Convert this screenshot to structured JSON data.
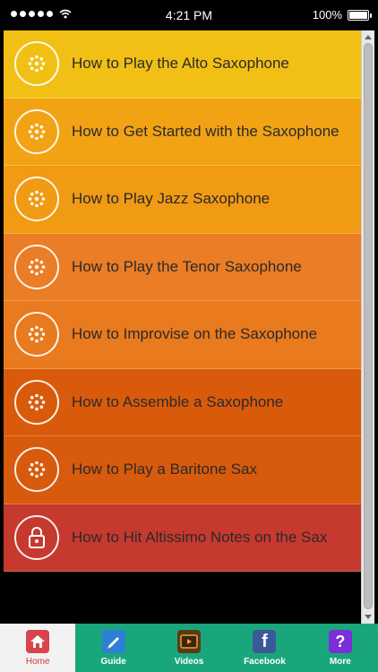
{
  "status_bar": {
    "time": "4:21 PM",
    "battery": "100%"
  },
  "list": [
    {
      "label": "How to Play the Alto Saxophone",
      "color": "#f2c014",
      "icon": "sax-dots-icon"
    },
    {
      "label": "How to Get Started with the Saxophone",
      "color": "#f2a314",
      "icon": "sax-dots-icon"
    },
    {
      "label": "How to Play Jazz Saxophone",
      "color": "#f19a14",
      "icon": "sax-dots-icon"
    },
    {
      "label": "How to Play the Tenor Saxophone",
      "color": "#ea7d26",
      "icon": "sax-dots-icon"
    },
    {
      "label": "How to Improvise on the Saxophone",
      "color": "#e97a1e",
      "icon": "sax-dots-icon"
    },
    {
      "label": "How to Assemble a Saxophone",
      "color": "#da5a0c",
      "icon": "sax-dots-icon"
    },
    {
      "label": "How to Play a Baritone Sax",
      "color": "#d85a0c",
      "icon": "sax-dots-icon"
    },
    {
      "label": "How to Hit Altissimo Notes on the Sax",
      "color": "#c6392f",
      "icon": "lock-icon"
    }
  ],
  "tabbar": {
    "background": "#1aa67c",
    "tabs": [
      {
        "label": "Home",
        "icon": "home-icon",
        "active": true
      },
      {
        "label": "Guide",
        "icon": "guide-icon",
        "active": false
      },
      {
        "label": "Videos",
        "icon": "videos-icon",
        "active": false
      },
      {
        "label": "Facebook",
        "icon": "facebook-icon",
        "active": false
      },
      {
        "label": "More",
        "icon": "more-icon",
        "active": false
      }
    ]
  }
}
